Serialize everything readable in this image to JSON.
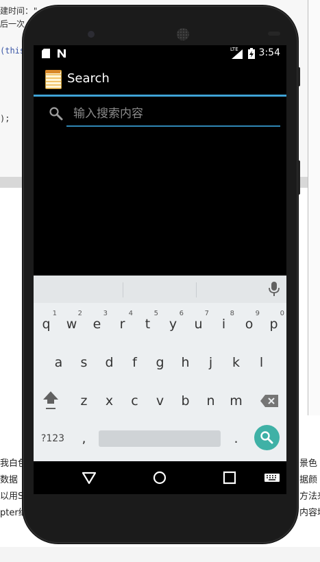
{
  "background": {
    "code_lines": [
      "建时间：\"",
      "后一次",
      "(this",
      ");"
    ],
    "doc_lines": [
      "我白色",
      "数据",
      "以用S",
      "pter继",
      "景色",
      "据颜",
      "方法来",
      "内容填"
    ]
  },
  "status_bar": {
    "left_icons": [
      "sd-card-icon",
      "n-icon"
    ],
    "network_label": "LTE",
    "time": "3:54"
  },
  "app_bar": {
    "title": "Search"
  },
  "search": {
    "placeholder": "输入搜索内容"
  },
  "keyboard": {
    "row1": [
      {
        "key": "q",
        "hint": "1"
      },
      {
        "key": "w",
        "hint": "2"
      },
      {
        "key": "e",
        "hint": "3"
      },
      {
        "key": "r",
        "hint": "4"
      },
      {
        "key": "t",
        "hint": "5"
      },
      {
        "key": "y",
        "hint": "6"
      },
      {
        "key": "u",
        "hint": "7"
      },
      {
        "key": "i",
        "hint": "8"
      },
      {
        "key": "o",
        "hint": "9"
      },
      {
        "key": "p",
        "hint": "0"
      }
    ],
    "row2": [
      "a",
      "s",
      "d",
      "f",
      "g",
      "h",
      "j",
      "k",
      "l"
    ],
    "row3": [
      "z",
      "x",
      "c",
      "v",
      "b",
      "n",
      "m"
    ],
    "symbols_label": "?123",
    "comma": ",",
    "period": ".",
    "accent_color": "#3fb1a6"
  },
  "colors": {
    "appbar_underline": "#3fa3d6",
    "input_underline": "#2f87b5"
  }
}
